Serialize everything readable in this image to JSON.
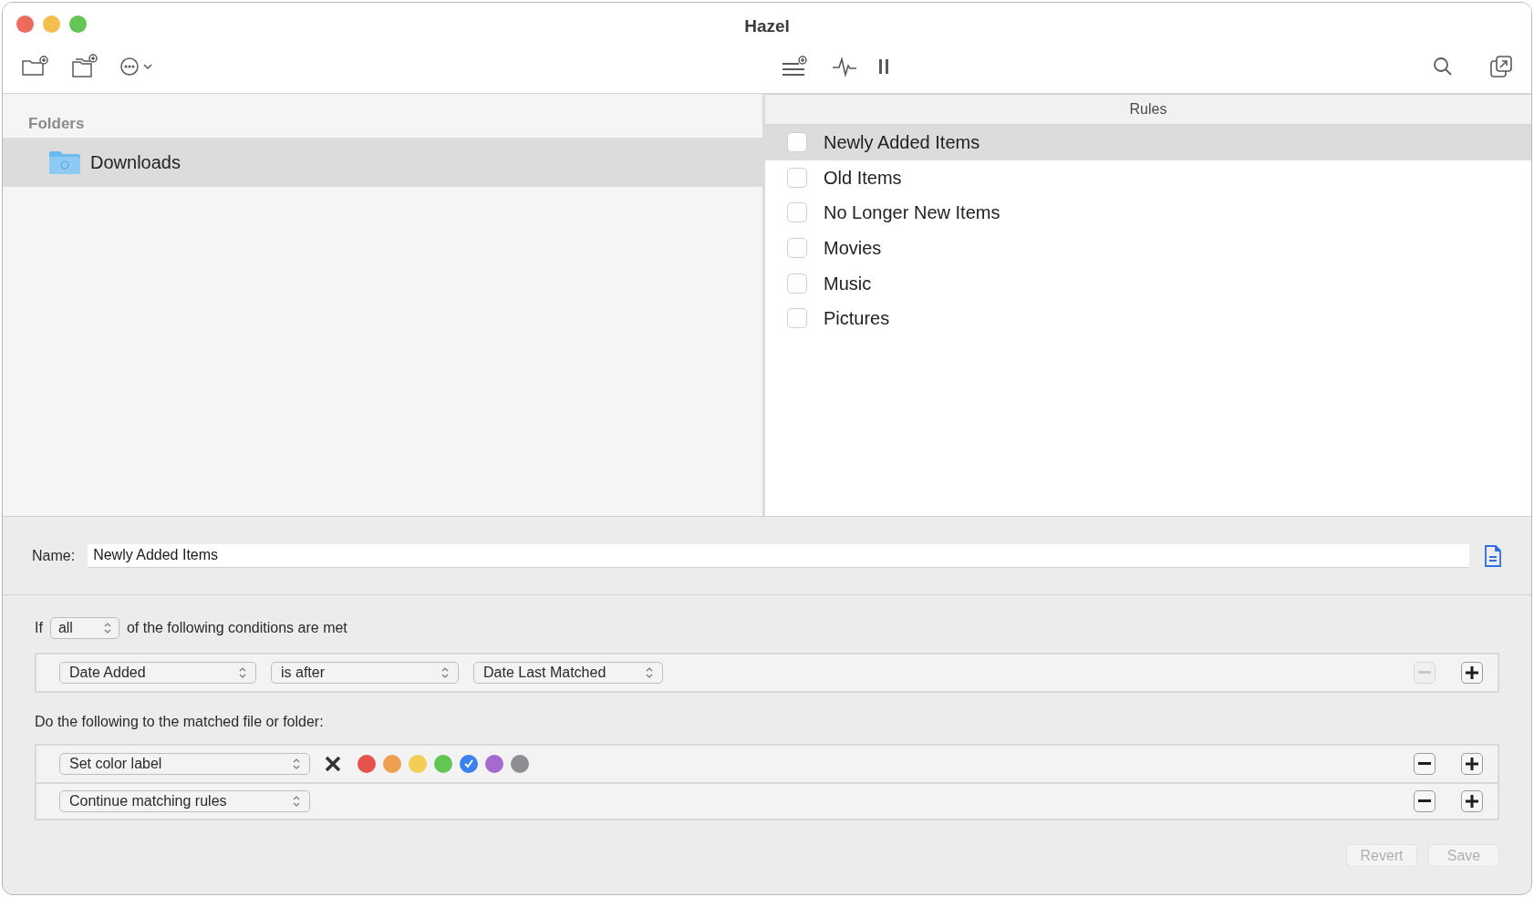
{
  "window": {
    "title": "Hazel"
  },
  "folders": {
    "header": "Folders",
    "items": [
      {
        "label": "Downloads",
        "selected": true
      }
    ]
  },
  "rules": {
    "header": "Rules",
    "items": [
      {
        "label": "Newly Added Items",
        "checked": false,
        "selected": true
      },
      {
        "label": "Old Items",
        "checked": false,
        "selected": false
      },
      {
        "label": "No Longer New Items",
        "checked": false,
        "selected": false
      },
      {
        "label": "Movies",
        "checked": false,
        "selected": false
      },
      {
        "label": "Music",
        "checked": false,
        "selected": false
      },
      {
        "label": "Pictures",
        "checked": false,
        "selected": false
      }
    ]
  },
  "editor": {
    "name_label": "Name:",
    "name_value": "Newly Added Items",
    "condition_prefix": "If",
    "match": "all",
    "condition_suffix": "of the following conditions are met",
    "conditions": [
      {
        "attribute": "Date Added",
        "operator": "is after",
        "value": "Date Last Matched",
        "remove_disabled": true
      }
    ],
    "actions_heading": "Do the following to the matched file or folder:",
    "actions": [
      {
        "kind": "color_label",
        "action": "Set color label",
        "remove_disabled": false,
        "colors": [
          {
            "color": "#e5534b",
            "selected": false
          },
          {
            "color": "#eda04f",
            "selected": false
          },
          {
            "color": "#f2ce55",
            "selected": false
          },
          {
            "color": "#62c554",
            "selected": false
          },
          {
            "color": "#3a82f0",
            "selected": true
          },
          {
            "color": "#a46ad0",
            "selected": false
          },
          {
            "color": "#8e8e92",
            "selected": false
          }
        ]
      },
      {
        "kind": "plain",
        "action": "Continue matching rules",
        "remove_disabled": false
      }
    ],
    "buttons": [
      {
        "label": "Revert",
        "disabled": true
      },
      {
        "label": "Save",
        "disabled": true
      }
    ]
  }
}
